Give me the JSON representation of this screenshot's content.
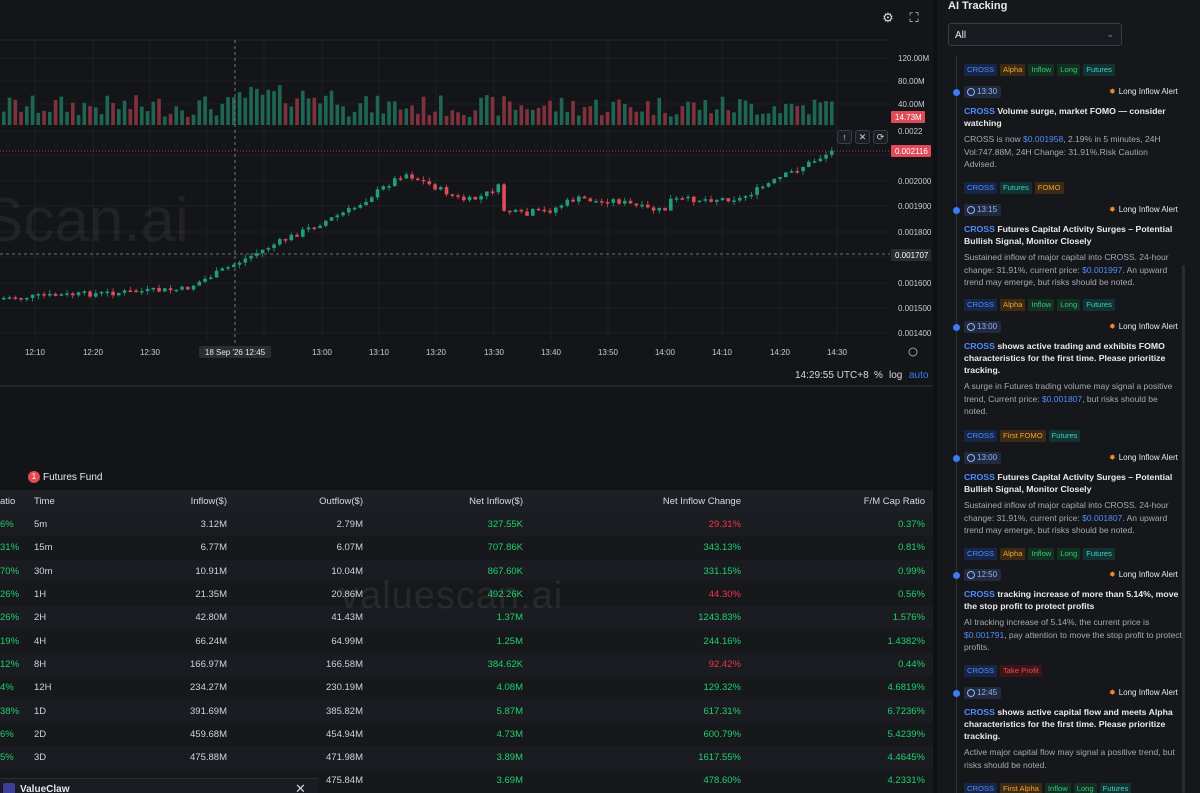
{
  "chart": {
    "watermark": "Scan.ai",
    "price_labels": [
      "120.00M",
      "80.00M",
      "40.00M",
      "0.0022",
      "0.002000",
      "0.001900",
      "0.001800",
      "0.001600",
      "0.001500",
      "0.001400"
    ],
    "volume_badge": "14.73M",
    "last_price_badge": "0.002116",
    "crosshair_price_badge": "0.001707",
    "time_labels": [
      "12:10",
      "12:20",
      "12:30",
      "13:00",
      "13:10",
      "13:20",
      "13:30",
      "13:40",
      "13:50",
      "14:00",
      "14:10",
      "14:20",
      "14:30"
    ],
    "crosshair_time": "18 Sep '26   12:45",
    "clock": "14:29:55 UTC+8",
    "percent": "%",
    "log": "log",
    "auto": "auto",
    "colors": {
      "up": "#1e9e7a",
      "down": "#e04b57",
      "background": "#141519"
    }
  },
  "fund": {
    "badge": "1",
    "title": "Futures Fund",
    "watermark": "valuescan.ai",
    "columns": [
      "atio",
      "Time",
      "Inflow($)",
      "Outflow($)",
      "Net Inflow($)",
      "Net Inflow Change",
      "F/M Cap Ratio"
    ],
    "rows": [
      {
        "lead": "6%",
        "time": "5m",
        "inflow": "3.12M",
        "outflow": "2.79M",
        "net": "327.55K",
        "change": "29.31%",
        "change_color": "r",
        "ratio": "0.37%"
      },
      {
        "lead": "31%",
        "time": "15m",
        "inflow": "6.77M",
        "outflow": "6.07M",
        "net": "707.86K",
        "change": "343.13%",
        "change_color": "g",
        "ratio": "0.81%"
      },
      {
        "lead": "70%",
        "time": "30m",
        "inflow": "10.91M",
        "outflow": "10.04M",
        "net": "867.60K",
        "change": "331.15%",
        "change_color": "g",
        "ratio": "0.99%"
      },
      {
        "lead": "26%",
        "time": "1H",
        "inflow": "21.35M",
        "outflow": "20.86M",
        "net": "492.26K",
        "change": "44.30%",
        "change_color": "r",
        "ratio": "0.56%"
      },
      {
        "lead": "26%",
        "time": "2H",
        "inflow": "42.80M",
        "outflow": "41.43M",
        "net": "1.37M",
        "change": "1243.83%",
        "change_color": "g",
        "ratio": "1.576%"
      },
      {
        "lead": "19%",
        "time": "4H",
        "inflow": "66.24M",
        "outflow": "64.99M",
        "net": "1.25M",
        "change": "244.16%",
        "change_color": "g",
        "ratio": "1.4382%"
      },
      {
        "lead": "12%",
        "time": "8H",
        "inflow": "166.97M",
        "outflow": "166.58M",
        "net": "384.62K",
        "change": "92.42%",
        "change_color": "r",
        "ratio": "0.44%"
      },
      {
        "lead": "4%",
        "time": "12H",
        "inflow": "234.27M",
        "outflow": "230.19M",
        "net": "4.08M",
        "change": "129.32%",
        "change_color": "g",
        "ratio": "4.6819%"
      },
      {
        "lead": "38%",
        "time": "1D",
        "inflow": "391.69M",
        "outflow": "385.82M",
        "net": "5.87M",
        "change": "617.31%",
        "change_color": "g",
        "ratio": "6.7236%"
      },
      {
        "lead": "6%",
        "time": "2D",
        "inflow": "459.68M",
        "outflow": "454.94M",
        "net": "4.73M",
        "change": "600.79%",
        "change_color": "g",
        "ratio": "5.4239%"
      },
      {
        "lead": "5%",
        "time": "3D",
        "inflow": "475.88M",
        "outflow": "471.98M",
        "net": "3.89M",
        "change": "1617.55%",
        "change_color": "g",
        "ratio": "4.4645%"
      },
      {
        "lead": "",
        "time": "",
        "inflow": "",
        "outflow": "475.84M",
        "net": "3.69M",
        "change": "478.60%",
        "change_color": "g",
        "ratio": "4.2331%"
      }
    ]
  },
  "valueclaw": {
    "label": "ValueClaw",
    "close": "✕"
  },
  "tracking": {
    "title": "AI Tracking",
    "filter": "All",
    "top_tags": [
      "CROSS",
      "Alpha",
      "Inflow",
      "Long",
      "Futures"
    ],
    "items": [
      {
        "time": "13:30",
        "alert": "Long Inflow Alert",
        "coin": "CROSS",
        "title": " Volume surge, market FOMO — consider watching",
        "desc_pre": "CROSS is now ",
        "price": "$0.001958",
        "desc_post": ", 2.19% in 5 minutes, 24H Vol:747.88M, 24H Change: 31.91%.Risk Caution Advised.",
        "tags": [
          "CROSS",
          "Futures",
          "FOMO"
        ]
      },
      {
        "time": "13:15",
        "alert": "Long Inflow Alert",
        "coin": "CROSS",
        "title": " Futures Capital Activity Surges – Potential Bullish Signal, Monitor Closely",
        "desc_pre": "Sustained inflow of major capital into CROSS. 24-hour change: 31.91%, current price: ",
        "price": "$0.001997",
        "desc_post": ". An upward trend may emerge, but risks should be noted.",
        "tags": [
          "CROSS",
          "Alpha",
          "Inflow",
          "Long",
          "Futures"
        ]
      },
      {
        "time": "13:00",
        "alert": "Long Inflow Alert",
        "coin": "CROSS",
        "title": " shows active trading and exhibits FOMO characteristics for the first time. Please prioritize tracking.",
        "desc_pre": "A surge in Futures trading volume may signal a positive trend, Current price: ",
        "price": "$0.001807",
        "desc_post": ", but risks should be noted.",
        "tags": [
          "CROSS",
          "First FOMO",
          "Futures"
        ]
      },
      {
        "time": "13:00",
        "alert": "Long Inflow Alert",
        "coin": "CROSS",
        "title": " Futures Capital Activity Surges – Potential Bullish Signal, Monitor Closely",
        "desc_pre": "Sustained inflow of major capital into CROSS. 24-hour change: 31.91%, current price: ",
        "price": "$0.001807",
        "desc_post": ". An upward trend may emerge, but risks should be noted.",
        "tags": [
          "CROSS",
          "Alpha",
          "Inflow",
          "Long",
          "Futures"
        ]
      },
      {
        "time": "12:50",
        "alert": "Long Inflow Alert",
        "coin": "CROSS",
        "title": " tracking increase of more than 5.14%, move the stop profit to protect profits",
        "desc_pre": "AI tracking increase of 5.14%, the current price is ",
        "price": "$0.001791",
        "desc_post": ", pay attention to move the stop profit to protect profits.",
        "tags": [
          "CROSS",
          "Take Profit"
        ]
      },
      {
        "time": "12:45",
        "alert": "Long Inflow Alert",
        "coin": "CROSS",
        "title": " shows active capital flow and meets Alpha characteristics for the first time. Please prioritize tracking.",
        "desc_pre": "Active major capital flow may signal a positive trend, but risks should be noted.",
        "price": "",
        "desc_post": "",
        "tags": [
          "CROSS",
          "First Alpha",
          "Inflow",
          "Long",
          "Futures"
        ]
      }
    ]
  }
}
